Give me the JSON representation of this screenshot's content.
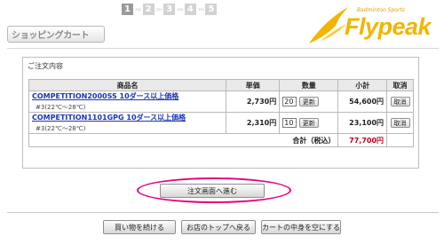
{
  "steps": [
    "1",
    "2",
    "3",
    "4",
    "5"
  ],
  "active_step": "1",
  "header": {
    "shop_title": "ショッピングカート",
    "logo_sub": "Badminton Sports",
    "logo_text": "Flypeak"
  },
  "order": {
    "section_title": "ご注文内容",
    "columns": [
      "商品名",
      "単価",
      "数量",
      "小計",
      "取消"
    ],
    "items": [
      {
        "name": "COMPETITION2000SS 10ダース以上価格",
        "variant": "#3(22℃～28℃)",
        "price": "2,730円",
        "qty": "20",
        "update_label": "更新",
        "subtotal": "54,600円",
        "delete_label": "取消"
      },
      {
        "name": "COMPETITION1101GPG 10ダース以上価格",
        "variant": "#3(22℃～28℃)",
        "price": "2,310円",
        "qty": "10",
        "update_label": "更新",
        "subtotal": "23,100円",
        "delete_label": "取消"
      }
    ],
    "total_label": "合計（税込）",
    "total_value": "77,700円"
  },
  "proceed_label": "注文画面へ進む",
  "bottom_buttons": {
    "continue": "買い物を続ける",
    "home": "お店のトップへ戻る",
    "empty": "カートの中身を空にする"
  },
  "colors": {
    "accent_ring": "#e6007e",
    "logo": "#f2b500",
    "link": "#1a34b8",
    "total": "#c0001a"
  }
}
